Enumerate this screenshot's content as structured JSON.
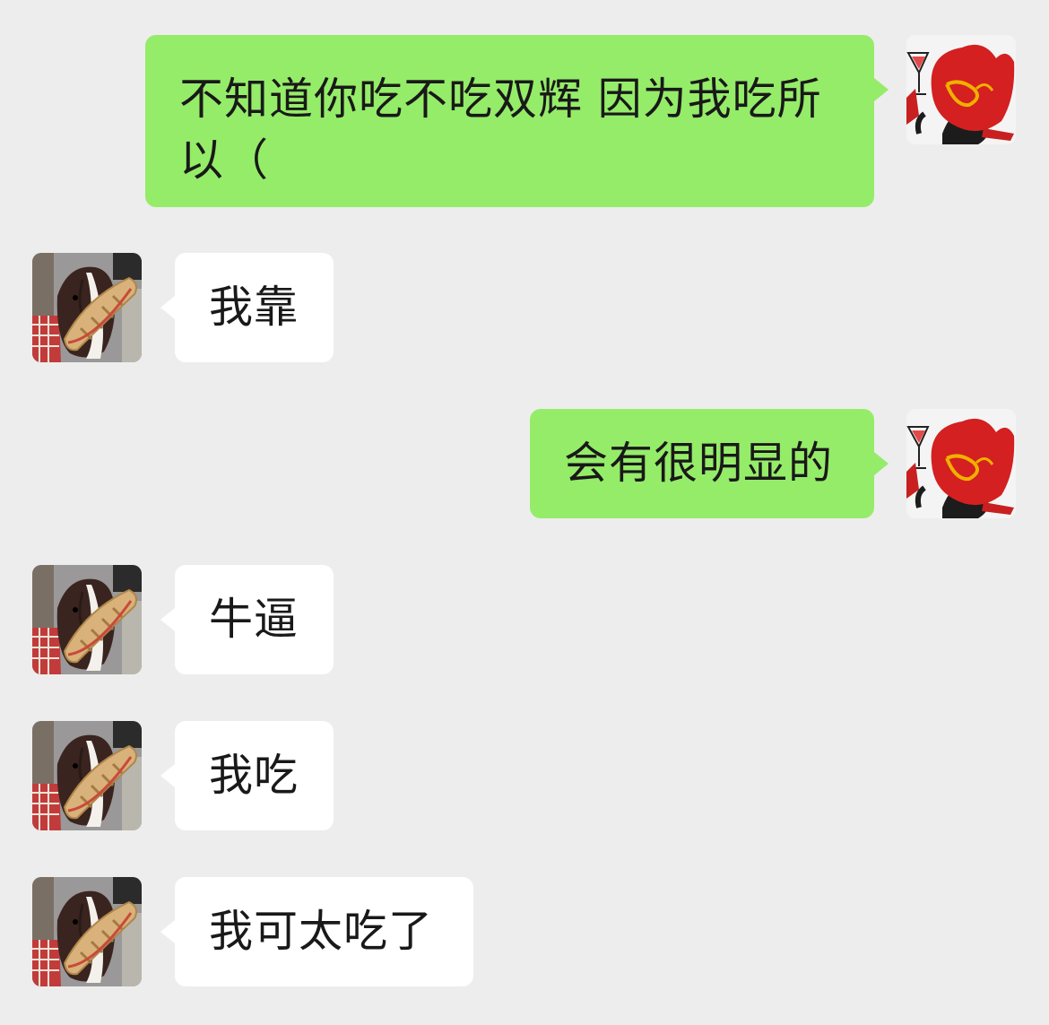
{
  "colors": {
    "background": "#ededed",
    "outgoing_bubble": "#95ec69",
    "incoming_bubble": "#ffffff",
    "text": "#191919"
  },
  "avatars": {
    "self": "red-cartoon-character-avatar",
    "contact": "border-collie-dog-avatar"
  },
  "messages": [
    {
      "side": "outgoing",
      "text": "不知道你吃不吃双辉 因为我吃所以（"
    },
    {
      "side": "incoming",
      "text": "我靠"
    },
    {
      "side": "outgoing",
      "text": "会有很明显的"
    },
    {
      "side": "incoming",
      "text": "牛逼"
    },
    {
      "side": "incoming",
      "text": "我吃"
    },
    {
      "side": "incoming",
      "text": "我可太吃了"
    }
  ],
  "msg1_line1": "不知道你吃不吃双辉 因为我吃所",
  "msg1_line2": "以（"
}
